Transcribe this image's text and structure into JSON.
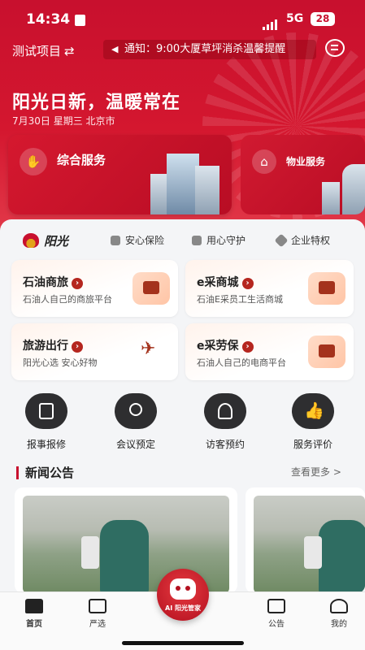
{
  "status": {
    "time": "14:34",
    "network": "5G",
    "battery": "28"
  },
  "header": {
    "project": "测试项目",
    "notice": "通知：9:00大厦草坪消杀温馨提醒",
    "slogan": "阳光日新，温暖常在",
    "date": "7月30日 星期三 北京市"
  },
  "services": [
    {
      "label": "综合服务",
      "icon": "handshake-icon"
    },
    {
      "label": "物业服务",
      "icon": "house-icon"
    }
  ],
  "brand": {
    "logo_text": "阳光",
    "tags": [
      {
        "label": "安心保险",
        "icon": "shield-icon"
      },
      {
        "label": "用心守护",
        "icon": "hand-care-icon"
      },
      {
        "label": "企业特权",
        "icon": "diamond-icon"
      }
    ]
  },
  "mini_services": [
    {
      "title": "石油商旅",
      "subtitle": "石油人自己的商旅平台",
      "icon": "briefcase-icon"
    },
    {
      "title": "e采商城",
      "subtitle": "石油E采员工生活商城",
      "icon": "shop-icon"
    },
    {
      "title": "旅游出行",
      "subtitle": "阳光心选 安心好物",
      "icon": "plane-icon"
    },
    {
      "title": "e采劳保",
      "subtitle": "石油人自己的电商平台",
      "icon": "gift-icon"
    }
  ],
  "quick_actions": [
    {
      "label": "报事报修",
      "icon": "report-icon"
    },
    {
      "label": "会议预定",
      "icon": "meeting-icon"
    },
    {
      "label": "访客预约",
      "icon": "visitor-icon"
    },
    {
      "label": "服务评价",
      "icon": "thumbs-up-icon"
    }
  ],
  "news": {
    "title": "新闻公告",
    "more": "查看更多 >"
  },
  "ai_button": {
    "label": "AI 阳光管家"
  },
  "nav": [
    {
      "label": "首页",
      "icon": "home-icon"
    },
    {
      "label": "严选",
      "icon": "bag-icon"
    },
    {
      "label": "公告",
      "icon": "notice-icon"
    },
    {
      "label": "我的",
      "icon": "person-icon"
    }
  ]
}
